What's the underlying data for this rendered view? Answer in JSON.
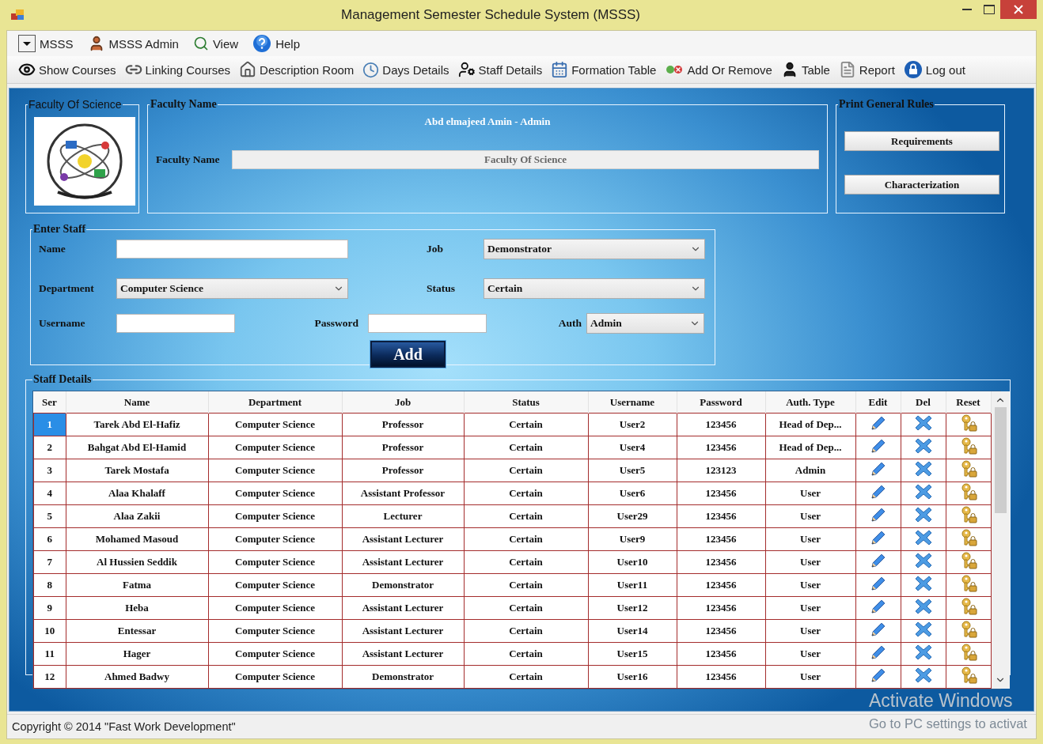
{
  "window": {
    "title": "Management Semester Schedule System (MSSS)"
  },
  "menu": [
    {
      "label": "MSSS"
    },
    {
      "label": "MSSS Admin"
    },
    {
      "label": "View"
    },
    {
      "label": "Help"
    }
  ],
  "toolbar": [
    {
      "label": "Show Courses"
    },
    {
      "label": "Linking Courses"
    },
    {
      "label": "Description Room"
    },
    {
      "label": "Days Details"
    },
    {
      "label": "Staff Details"
    },
    {
      "label": "Formation Table"
    },
    {
      "label": "Add Or Remove"
    },
    {
      "label": "Table"
    },
    {
      "label": "Report"
    },
    {
      "label": "Log out"
    }
  ],
  "logo_panel": {
    "title": "Faculty Of Science"
  },
  "faculty_panel": {
    "title": "Faculty Name",
    "user": "Abd elmajeed Amin - Admin",
    "label": "Faculty Name",
    "value": "Faculty Of Science"
  },
  "print_rules": {
    "title": "Print General Rules",
    "buttons": [
      "Requirements",
      "Characterization"
    ]
  },
  "enter_staff": {
    "title": "Enter Staff",
    "name": {
      "label": "Name"
    },
    "job": {
      "label": "Job",
      "value": "Demonstrator"
    },
    "department": {
      "label": "Department",
      "value": "Computer Science"
    },
    "status": {
      "label": "Status",
      "value": "Certain"
    },
    "username": {
      "label": "Username"
    },
    "password": {
      "label": "Password"
    },
    "auth": {
      "label": "Auth",
      "value": "Admin"
    },
    "add_button": "Add"
  },
  "staff_details": {
    "title": "Staff Details",
    "columns": [
      "Ser",
      "Name",
      "Department",
      "Job",
      "Status",
      "Username",
      "Password",
      "Auth. Type",
      "Edit",
      "Del",
      "Reset"
    ],
    "rows": [
      {
        "ser": "1",
        "name": "Tarek Abd El-Hafiz",
        "department": "Computer Science",
        "job": "Professor",
        "status": "Certain",
        "username": "User2",
        "password": "123456",
        "auth_type": "Head of Dep...",
        "selected": true
      },
      {
        "ser": "2",
        "name": "Bahgat Abd El-Hamid",
        "department": "Computer Science",
        "job": "Professor",
        "status": "Certain",
        "username": "User4",
        "password": "123456",
        "auth_type": "Head of Dep...",
        "selected": false
      },
      {
        "ser": "3",
        "name": "Tarek Mostafa",
        "department": "Computer Science",
        "job": "Professor",
        "status": "Certain",
        "username": "User5",
        "password": "123123",
        "auth_type": "Admin",
        "selected": false
      },
      {
        "ser": "4",
        "name": "Alaa Khalaff",
        "department": "Computer Science",
        "job": "Assistant Professor",
        "status": "Certain",
        "username": "User6",
        "password": "123456",
        "auth_type": "User",
        "selected": false
      },
      {
        "ser": "5",
        "name": "Alaa Zakii",
        "department": "Computer Science",
        "job": "Lecturer",
        "status": "Certain",
        "username": "User29",
        "password": "123456",
        "auth_type": "User",
        "selected": false
      },
      {
        "ser": "6",
        "name": "Mohamed Masoud",
        "department": "Computer Science",
        "job": "Assistant Lecturer",
        "status": "Certain",
        "username": "User9",
        "password": "123456",
        "auth_type": "User",
        "selected": false
      },
      {
        "ser": "7",
        "name": "Al Hussien Seddik",
        "department": "Computer Science",
        "job": "Assistant Lecturer",
        "status": "Certain",
        "username": "User10",
        "password": "123456",
        "auth_type": "User",
        "selected": false
      },
      {
        "ser": "8",
        "name": "Fatma",
        "department": "Computer Science",
        "job": "Demonstrator",
        "status": "Certain",
        "username": "User11",
        "password": "123456",
        "auth_type": "User",
        "selected": false
      },
      {
        "ser": "9",
        "name": "Heba",
        "department": "Computer Science",
        "job": "Assistant Lecturer",
        "status": "Certain",
        "username": "User12",
        "password": "123456",
        "auth_type": "User",
        "selected": false
      },
      {
        "ser": "10",
        "name": "Entessar",
        "department": "Computer Science",
        "job": "Assistant Lecturer",
        "status": "Certain",
        "username": "User14",
        "password": "123456",
        "auth_type": "User",
        "selected": false
      },
      {
        "ser": "11",
        "name": "Hager",
        "department": "Computer Science",
        "job": "Assistant Lecturer",
        "status": "Certain",
        "username": "User15",
        "password": "123456",
        "auth_type": "User",
        "selected": false
      },
      {
        "ser": "12",
        "name": "Ahmed Badwy",
        "department": "Computer Science",
        "job": "Demonstrator",
        "status": "Certain",
        "username": "User16",
        "password": "123456",
        "auth_type": "User",
        "selected": false
      }
    ]
  },
  "status_bar": {
    "copyright": "Copyright © 2014 \"Fast Work Development\""
  },
  "activation_notice": {
    "title": "Activate Windows",
    "subtitle": "Go to PC settings to activat"
  }
}
